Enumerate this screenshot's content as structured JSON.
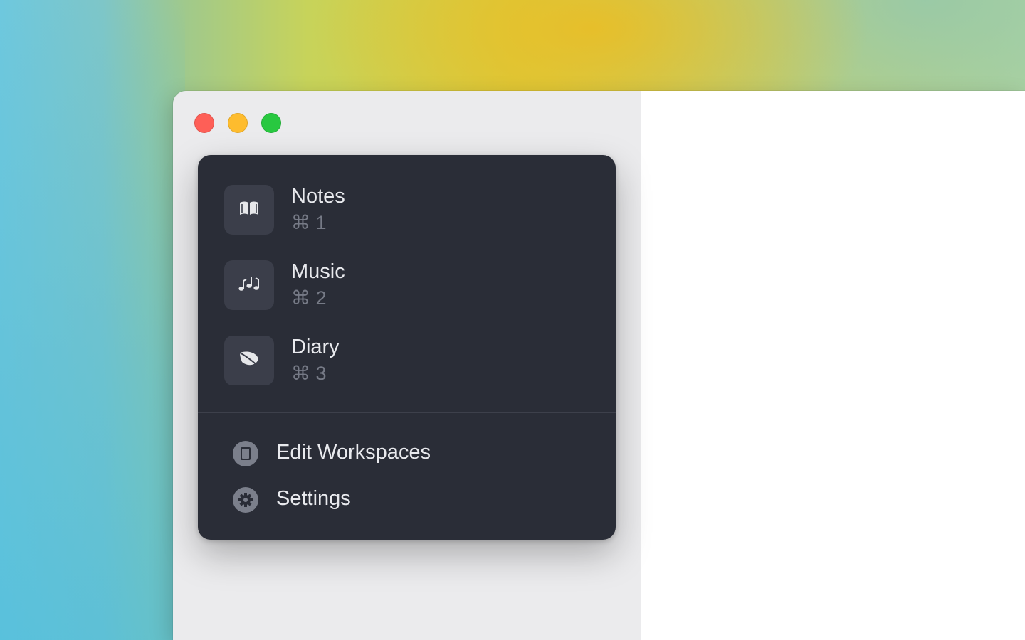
{
  "window": {
    "controls": [
      "close",
      "minimize",
      "zoom"
    ]
  },
  "workspaces": [
    {
      "name": "Notes",
      "shortcut": "⌘ 1",
      "icon": "book-icon"
    },
    {
      "name": "Music",
      "shortcut": "⌘ 2",
      "icon": "music-notes-icon"
    },
    {
      "name": "Diary",
      "shortcut": "⌘ 3",
      "icon": "leaf-icon"
    }
  ],
  "actions": {
    "edit_workspaces": "Edit Workspaces",
    "settings": "Settings"
  },
  "colors": {
    "popover_bg": "#2a2d37",
    "tile_bg": "#3b3e4a",
    "text_primary": "#e9eaee",
    "text_secondary": "#767a86",
    "close": "#fe5f57",
    "minimize": "#febc2e",
    "zoom": "#28c840"
  }
}
